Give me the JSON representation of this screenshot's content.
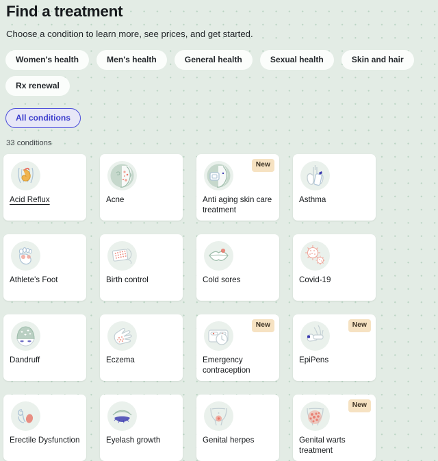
{
  "header": {
    "title": "Find a treatment",
    "subtitle": "Choose a condition to learn more, see prices, and get started."
  },
  "filters": {
    "items": [
      {
        "label": "Women's health",
        "selected": false
      },
      {
        "label": "Men's health",
        "selected": false
      },
      {
        "label": "General health",
        "selected": false
      },
      {
        "label": "Sexual health",
        "selected": false
      },
      {
        "label": "Skin and hair",
        "selected": false
      },
      {
        "label": "Rx renewal",
        "selected": false
      },
      {
        "label": "All conditions",
        "selected": true
      }
    ]
  },
  "results": {
    "count_label": "33 conditions"
  },
  "colors": {
    "page_background": "#e3ece5",
    "dot_grid": "#b9d3c2",
    "card_background": "#ffffff",
    "accent_selected": "#4b4ddb",
    "badge_new_background": "#f6e2c2",
    "icon_circle": "#eaf1ec"
  },
  "cards": [
    {
      "label": "Acid Reflux",
      "icon": "stomach-icon",
      "badge": null,
      "underlined": true
    },
    {
      "label": "Acne",
      "icon": "face-acne-icon",
      "badge": null,
      "underlined": false
    },
    {
      "label": "Anti aging skin care treatment",
      "icon": "face-anti-aging-icon",
      "badge": "New",
      "underlined": false
    },
    {
      "label": "Asthma",
      "icon": "lungs-inhaler-icon",
      "badge": null,
      "underlined": false
    },
    {
      "label": "Athlete's Foot",
      "icon": "foot-icon",
      "badge": null,
      "underlined": false
    },
    {
      "label": "Birth control",
      "icon": "pill-pack-icon",
      "badge": null,
      "underlined": false
    },
    {
      "label": "Cold sores",
      "icon": "lips-sore-icon",
      "badge": null,
      "underlined": false
    },
    {
      "label": "Covid-19",
      "icon": "virus-icon",
      "badge": null,
      "underlined": false
    },
    {
      "label": "Dandruff",
      "icon": "head-flakes-icon",
      "badge": null,
      "underlined": false
    },
    {
      "label": "Eczema",
      "icon": "hand-rash-icon",
      "badge": null,
      "underlined": false
    },
    {
      "label": "Emergency contraception",
      "icon": "pill-card-clock-icon",
      "badge": "New",
      "underlined": false
    },
    {
      "label": "EpiPens",
      "icon": "epipen-hand-icon",
      "badge": "New",
      "underlined": false
    },
    {
      "label": "Erectile Dysfunction",
      "icon": "male-anatomy-icon",
      "badge": null,
      "underlined": false
    },
    {
      "label": "Eyelash growth",
      "icon": "eyelash-icon",
      "badge": null,
      "underlined": false
    },
    {
      "label": "Genital herpes",
      "icon": "pelvis-sore-icon",
      "badge": null,
      "underlined": false
    },
    {
      "label": "Genital warts treatment",
      "icon": "pelvis-warts-icon",
      "badge": "New",
      "underlined": false
    }
  ]
}
